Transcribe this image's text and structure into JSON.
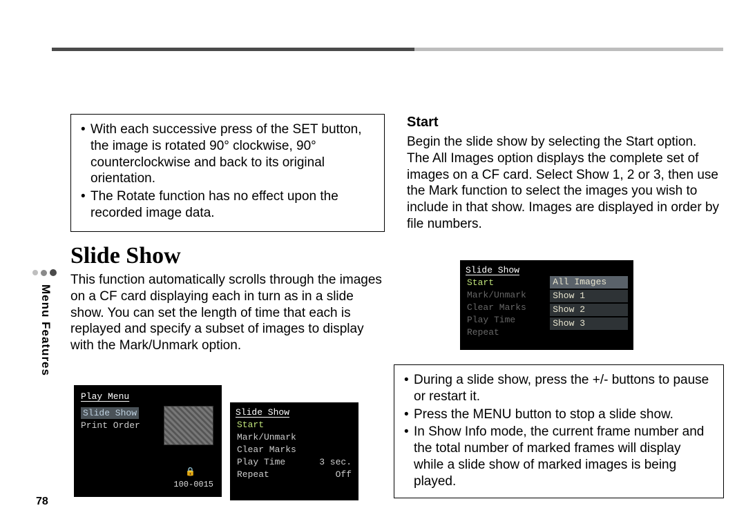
{
  "page_number": "78",
  "side_label": "Menu Features",
  "left_col": {
    "box_items": [
      "With each successive press of the SET button, the image is rotated 90° clockwise, 90° counterclockwise and back to its original orientation.",
      "The Rotate function has no effect upon the recorded image data."
    ],
    "heading": "Slide Show",
    "paragraph": "This function automatically scrolls through the images on a CF card displaying each in turn as in a slide show. You can set the length of time that each is replayed and specify a subset of images to display with the Mark/Unmark option."
  },
  "right_col": {
    "heading": "Start",
    "para1": "Begin the slide show by selecting the Start option.",
    "para2": "The All Images option displays the complete set of images on a CF card. Select Show 1, 2 or 3, then use the Mark function to select the images you wish to include in that show. Images are displayed in order by file numbers.",
    "box_items": [
      "During a slide show, press the +/- buttons to pause or restart it.",
      "Press the MENU button to stop a slide show.",
      "In Show Info mode, the current frame number and the total number of marked frames will display while a slide show of marked images is being played."
    ]
  },
  "screen1": {
    "title": "Play Menu",
    "item_selected": "Slide Show",
    "item2": "Print Order",
    "filenum": "100-0015"
  },
  "screen2": {
    "title": "Slide Show",
    "rows": [
      {
        "label": "Start",
        "value": "",
        "hl": true
      },
      {
        "label": "Mark/Unmark",
        "value": ""
      },
      {
        "label": "Clear Marks",
        "value": ""
      },
      {
        "label": "Play Time",
        "value": "3 sec."
      },
      {
        "label": "Repeat",
        "value": "Off"
      }
    ]
  },
  "screen3": {
    "title": "Slide Show",
    "left_rows": [
      {
        "label": "Start",
        "hl": true
      },
      {
        "label": "Mark/Unmark",
        "dim": true
      },
      {
        "label": "Clear Marks",
        "dim": true
      },
      {
        "label": "Play Time",
        "dim": true
      },
      {
        "label": "Repeat",
        "dim": true
      }
    ],
    "right_rows": [
      {
        "label": "All Images",
        "sel": true
      },
      {
        "label": "Show 1"
      },
      {
        "label": "Show 2"
      },
      {
        "label": "Show 3"
      }
    ]
  }
}
